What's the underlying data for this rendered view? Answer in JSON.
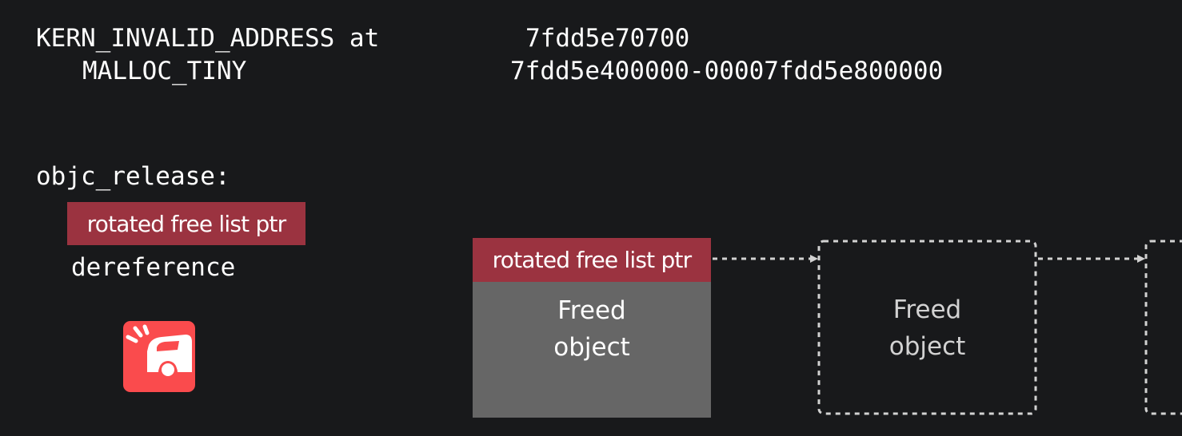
{
  "crash": {
    "exception_label": "KERN_INVALID_ADDRESS at",
    "exception_address": "7fdd5e70700",
    "region_label": "MALLOC_TINY",
    "region_range": "7fdd5e400000-00007fdd5e800000"
  },
  "code": {
    "function": "objc_release:",
    "highlighted_step": "rotated free list ptr",
    "next_step": "dereference"
  },
  "diagram": {
    "nodes": [
      {
        "header": "rotated free list ptr",
        "line1": "Freed",
        "line2": "object",
        "state": "solid"
      },
      {
        "line1": "Freed",
        "line2": "object",
        "state": "dashed"
      },
      {
        "state": "dashed"
      }
    ]
  },
  "colors": {
    "background": "#18191b",
    "highlight": "#9b3340",
    "freed_object_fill": "#666666",
    "crash_icon": "#fa4b4d",
    "dashed": "#d2d2d2"
  },
  "icons": {
    "crash": "crash-icon"
  }
}
